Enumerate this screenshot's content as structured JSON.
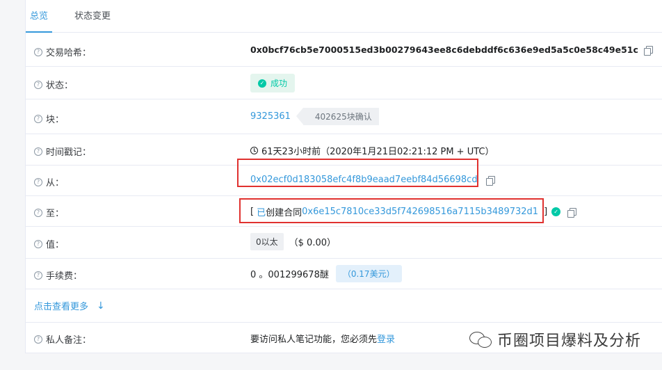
{
  "tabs": {
    "overview": "总览",
    "state_changes": "状态变更"
  },
  "rows": {
    "tx_hash": {
      "label": "交易哈希：",
      "value": "0x0bcf76cb5e7000515ed3b00279643ee8c6debddf6c636e9ed5a5c0e58c49e51c"
    },
    "status": {
      "label": "状态：",
      "value": "成功"
    },
    "block": {
      "label": "块：",
      "number": "9325361",
      "confirmations": "402625块确认"
    },
    "timestamp": {
      "label": "时间戳记：",
      "value": "61天23小时前（2020年1月21日02:21:12 PM + UTC）"
    },
    "from": {
      "label": "从：",
      "value": "0x02ecf0d183058efc4f8b9eaad7eebf84d56698cd"
    },
    "to": {
      "label": "至：",
      "bracket_open": "[",
      "prefix": "已",
      "created": " 创建合同",
      "contract": "0x6e15c7810ce33d5f742698516a7115b3489732d1",
      "bracket_close": "]"
    },
    "value": {
      "label": "值：",
      "amount": "0以太",
      "usd": "（$ 0.00）"
    },
    "fee": {
      "label": "手续费：",
      "amount": "0 。001299678醚",
      "usd": "（0.17美元）"
    },
    "note": {
      "label": "私人备注：",
      "text": "要访问私人笔记功能，您必须先",
      "login": "登录"
    }
  },
  "more": {
    "label": "点击查看更多"
  },
  "watermark": {
    "text": "币圈项目爆料及分析"
  },
  "colors": {
    "link": "#3498db",
    "success": "#00c9a7",
    "highlight": "#e0312f"
  }
}
